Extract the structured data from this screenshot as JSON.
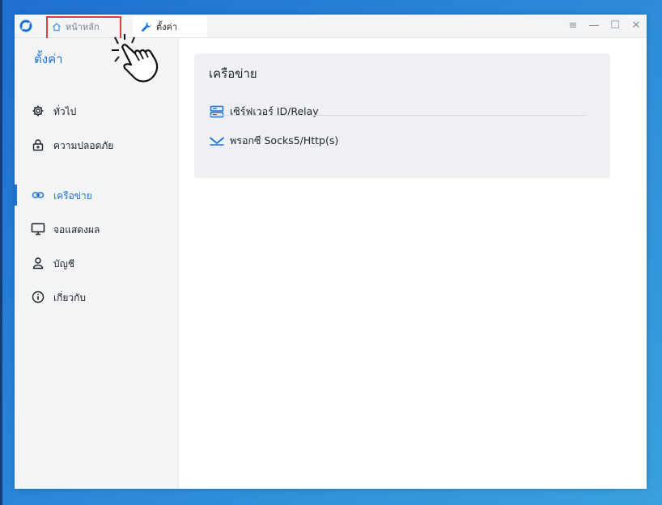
{
  "titlebar": {
    "tabs": [
      {
        "label": "หน้าหลัก",
        "icon": "home-icon"
      },
      {
        "label": "ตั้งค่า",
        "icon": "wrench-icon"
      }
    ],
    "controls": {
      "menu": "≡",
      "minimize": "—",
      "maximize": "☐",
      "close": "✕"
    }
  },
  "sidebar": {
    "title": "ตั้งค่า",
    "items": [
      {
        "label": "ทั่วไป",
        "icon": "gear-icon"
      },
      {
        "label": "ความปลอดภัย",
        "icon": "lock-icon"
      },
      {
        "label": "เครือข่าย",
        "icon": "link-icon",
        "active": true
      },
      {
        "label": "จอแสดงผล",
        "icon": "monitor-icon"
      },
      {
        "label": "บัญชี",
        "icon": "user-icon"
      },
      {
        "label": "เกี่ยวกับ",
        "icon": "info-icon"
      }
    ]
  },
  "main": {
    "card": {
      "title": "เครือข่าย",
      "rows": [
        {
          "label": "เซิร์ฟเวอร์ ID/Relay",
          "icon": "server-icon"
        },
        {
          "label": "พรอกซี Socks5/Http(s)",
          "icon": "proxy-icon"
        }
      ]
    }
  },
  "colors": {
    "accent": "#1f72d6",
    "highlight": "#e53935"
  }
}
